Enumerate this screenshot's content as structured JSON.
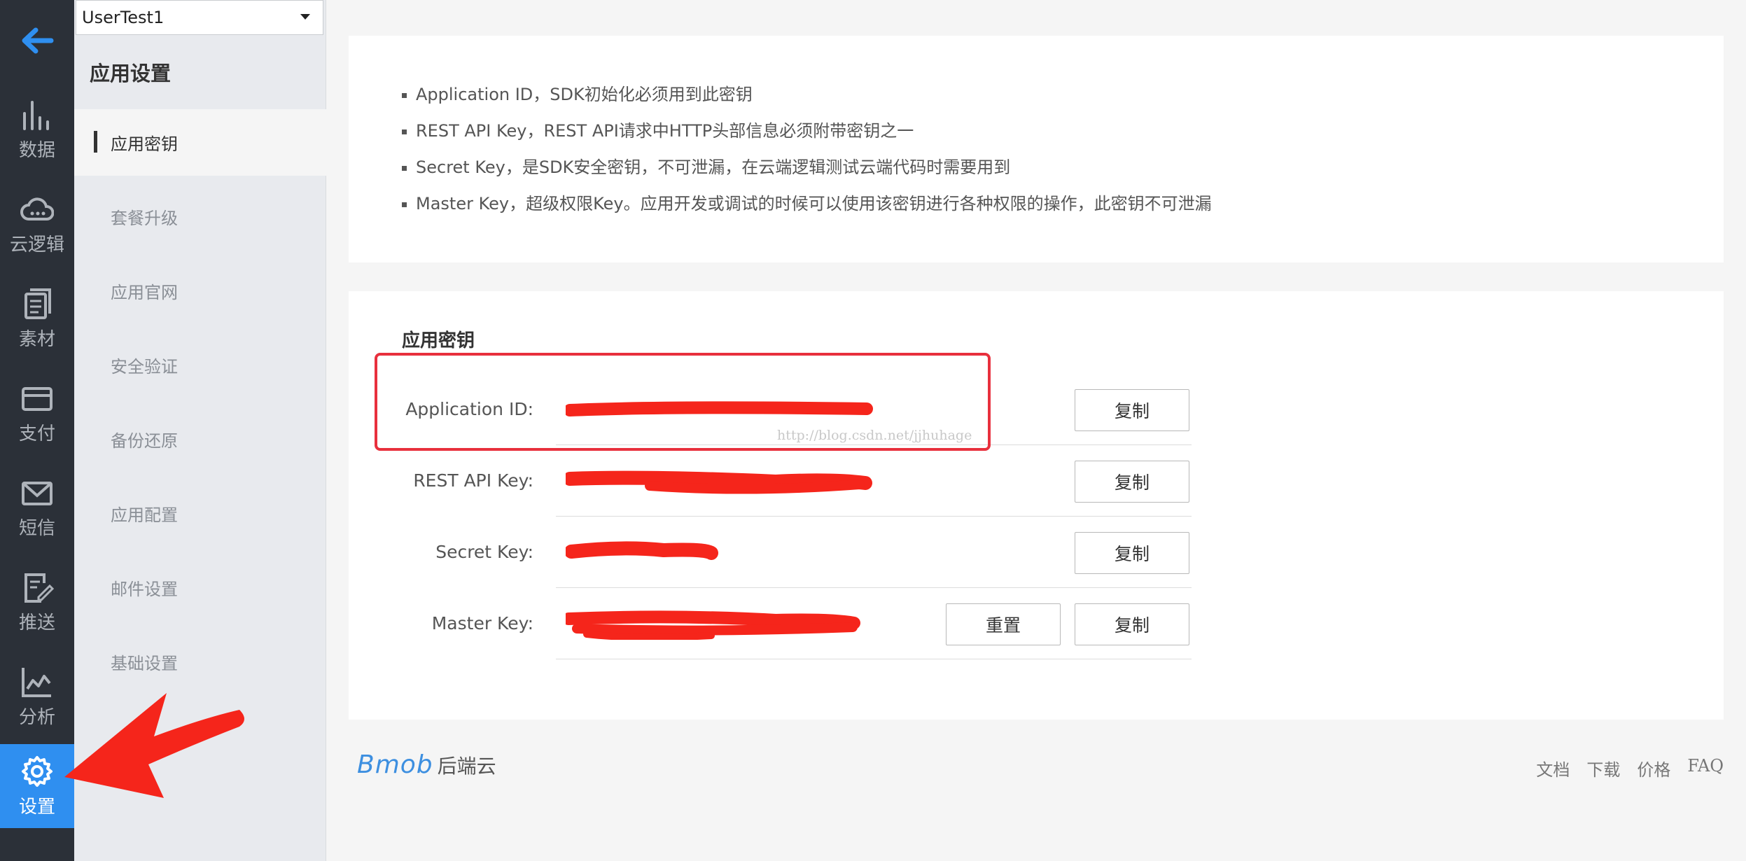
{
  "rail": {
    "items": [
      {
        "label": "数据",
        "icon": "bar-chart-icon"
      },
      {
        "label": "云逻辑",
        "icon": "cloud-icon"
      },
      {
        "label": "素材",
        "icon": "document-icon"
      },
      {
        "label": "支付",
        "icon": "card-icon"
      },
      {
        "label": "短信",
        "icon": "mail-icon"
      },
      {
        "label": "推送",
        "icon": "edit-icon"
      },
      {
        "label": "分析",
        "icon": "line-chart-icon"
      },
      {
        "label": "设置",
        "icon": "gear-icon"
      }
    ],
    "active_color": "#2f8ff0"
  },
  "sidebar": {
    "app_select": "UserTest1",
    "title": "应用设置",
    "items": [
      {
        "label": "应用密钥"
      },
      {
        "label": "套餐升级"
      },
      {
        "label": "应用官网"
      },
      {
        "label": "安全验证"
      },
      {
        "label": "备份还原"
      },
      {
        "label": "应用配置"
      },
      {
        "label": "邮件设置"
      },
      {
        "label": "基础设置"
      }
    ]
  },
  "info": {
    "bullets": [
      "Application ID，SDK初始化必须用到此密钥",
      "REST API Key，REST API请求中HTTP头部信息必须附带密钥之一",
      "Secret Key，是SDK安全密钥，不可泄漏，在云端逻辑测试云端代码时需要用到",
      "Master Key，超级权限Key。应用开发或调试的时候可以使用该密钥进行各种权限的操作，此密钥不可泄漏"
    ]
  },
  "keys": {
    "title": "应用密钥",
    "rows": [
      {
        "label": "Application ID:",
        "copy": "复制"
      },
      {
        "label": "REST API Key:",
        "copy": "复制"
      },
      {
        "label": "Secret Key:",
        "copy": "复制"
      },
      {
        "label": "Master Key:",
        "copy": "复制",
        "reset": "重置"
      }
    ],
    "watermark": "http://blog.csdn.net/jjhuhage",
    "redaction_color": "#f5251b"
  },
  "footer": {
    "brand_logo": "Bmob",
    "brand_sub": "后端云",
    "links": [
      "文档",
      "下载",
      "价格",
      "FAQ"
    ]
  }
}
